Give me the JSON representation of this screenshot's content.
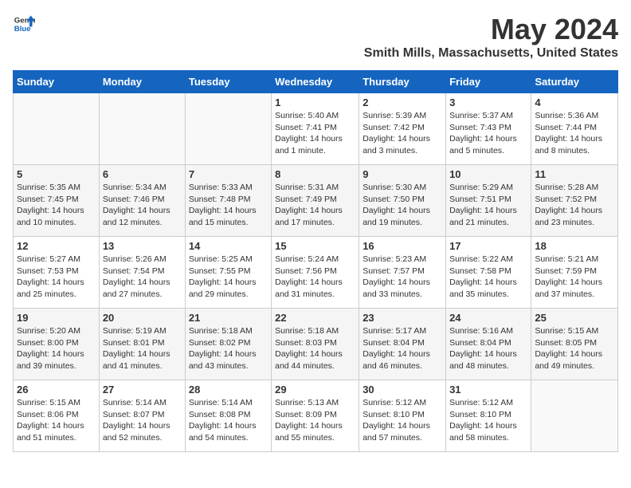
{
  "logo": {
    "text_general": "General",
    "text_blue": "Blue"
  },
  "title": "May 2024",
  "subtitle": "Smith Mills, Massachusetts, United States",
  "days_of_week": [
    "Sunday",
    "Monday",
    "Tuesday",
    "Wednesday",
    "Thursday",
    "Friday",
    "Saturday"
  ],
  "weeks": [
    [
      {
        "day": "",
        "sunrise": "",
        "sunset": "",
        "daylight": ""
      },
      {
        "day": "",
        "sunrise": "",
        "sunset": "",
        "daylight": ""
      },
      {
        "day": "",
        "sunrise": "",
        "sunset": "",
        "daylight": ""
      },
      {
        "day": "1",
        "sunrise": "Sunrise: 5:40 AM",
        "sunset": "Sunset: 7:41 PM",
        "daylight": "Daylight: 14 hours and 1 minute."
      },
      {
        "day": "2",
        "sunrise": "Sunrise: 5:39 AM",
        "sunset": "Sunset: 7:42 PM",
        "daylight": "Daylight: 14 hours and 3 minutes."
      },
      {
        "day": "3",
        "sunrise": "Sunrise: 5:37 AM",
        "sunset": "Sunset: 7:43 PM",
        "daylight": "Daylight: 14 hours and 5 minutes."
      },
      {
        "day": "4",
        "sunrise": "Sunrise: 5:36 AM",
        "sunset": "Sunset: 7:44 PM",
        "daylight": "Daylight: 14 hours and 8 minutes."
      }
    ],
    [
      {
        "day": "5",
        "sunrise": "Sunrise: 5:35 AM",
        "sunset": "Sunset: 7:45 PM",
        "daylight": "Daylight: 14 hours and 10 minutes."
      },
      {
        "day": "6",
        "sunrise": "Sunrise: 5:34 AM",
        "sunset": "Sunset: 7:46 PM",
        "daylight": "Daylight: 14 hours and 12 minutes."
      },
      {
        "day": "7",
        "sunrise": "Sunrise: 5:33 AM",
        "sunset": "Sunset: 7:48 PM",
        "daylight": "Daylight: 14 hours and 15 minutes."
      },
      {
        "day": "8",
        "sunrise": "Sunrise: 5:31 AM",
        "sunset": "Sunset: 7:49 PM",
        "daylight": "Daylight: 14 hours and 17 minutes."
      },
      {
        "day": "9",
        "sunrise": "Sunrise: 5:30 AM",
        "sunset": "Sunset: 7:50 PM",
        "daylight": "Daylight: 14 hours and 19 minutes."
      },
      {
        "day": "10",
        "sunrise": "Sunrise: 5:29 AM",
        "sunset": "Sunset: 7:51 PM",
        "daylight": "Daylight: 14 hours and 21 minutes."
      },
      {
        "day": "11",
        "sunrise": "Sunrise: 5:28 AM",
        "sunset": "Sunset: 7:52 PM",
        "daylight": "Daylight: 14 hours and 23 minutes."
      }
    ],
    [
      {
        "day": "12",
        "sunrise": "Sunrise: 5:27 AM",
        "sunset": "Sunset: 7:53 PM",
        "daylight": "Daylight: 14 hours and 25 minutes."
      },
      {
        "day": "13",
        "sunrise": "Sunrise: 5:26 AM",
        "sunset": "Sunset: 7:54 PM",
        "daylight": "Daylight: 14 hours and 27 minutes."
      },
      {
        "day": "14",
        "sunrise": "Sunrise: 5:25 AM",
        "sunset": "Sunset: 7:55 PM",
        "daylight": "Daylight: 14 hours and 29 minutes."
      },
      {
        "day": "15",
        "sunrise": "Sunrise: 5:24 AM",
        "sunset": "Sunset: 7:56 PM",
        "daylight": "Daylight: 14 hours and 31 minutes."
      },
      {
        "day": "16",
        "sunrise": "Sunrise: 5:23 AM",
        "sunset": "Sunset: 7:57 PM",
        "daylight": "Daylight: 14 hours and 33 minutes."
      },
      {
        "day": "17",
        "sunrise": "Sunrise: 5:22 AM",
        "sunset": "Sunset: 7:58 PM",
        "daylight": "Daylight: 14 hours and 35 minutes."
      },
      {
        "day": "18",
        "sunrise": "Sunrise: 5:21 AM",
        "sunset": "Sunset: 7:59 PM",
        "daylight": "Daylight: 14 hours and 37 minutes."
      }
    ],
    [
      {
        "day": "19",
        "sunrise": "Sunrise: 5:20 AM",
        "sunset": "Sunset: 8:00 PM",
        "daylight": "Daylight: 14 hours and 39 minutes."
      },
      {
        "day": "20",
        "sunrise": "Sunrise: 5:19 AM",
        "sunset": "Sunset: 8:01 PM",
        "daylight": "Daylight: 14 hours and 41 minutes."
      },
      {
        "day": "21",
        "sunrise": "Sunrise: 5:18 AM",
        "sunset": "Sunset: 8:02 PM",
        "daylight": "Daylight: 14 hours and 43 minutes."
      },
      {
        "day": "22",
        "sunrise": "Sunrise: 5:18 AM",
        "sunset": "Sunset: 8:03 PM",
        "daylight": "Daylight: 14 hours and 44 minutes."
      },
      {
        "day": "23",
        "sunrise": "Sunrise: 5:17 AM",
        "sunset": "Sunset: 8:04 PM",
        "daylight": "Daylight: 14 hours and 46 minutes."
      },
      {
        "day": "24",
        "sunrise": "Sunrise: 5:16 AM",
        "sunset": "Sunset: 8:04 PM",
        "daylight": "Daylight: 14 hours and 48 minutes."
      },
      {
        "day": "25",
        "sunrise": "Sunrise: 5:15 AM",
        "sunset": "Sunset: 8:05 PM",
        "daylight": "Daylight: 14 hours and 49 minutes."
      }
    ],
    [
      {
        "day": "26",
        "sunrise": "Sunrise: 5:15 AM",
        "sunset": "Sunset: 8:06 PM",
        "daylight": "Daylight: 14 hours and 51 minutes."
      },
      {
        "day": "27",
        "sunrise": "Sunrise: 5:14 AM",
        "sunset": "Sunset: 8:07 PM",
        "daylight": "Daylight: 14 hours and 52 minutes."
      },
      {
        "day": "28",
        "sunrise": "Sunrise: 5:14 AM",
        "sunset": "Sunset: 8:08 PM",
        "daylight": "Daylight: 14 hours and 54 minutes."
      },
      {
        "day": "29",
        "sunrise": "Sunrise: 5:13 AM",
        "sunset": "Sunset: 8:09 PM",
        "daylight": "Daylight: 14 hours and 55 minutes."
      },
      {
        "day": "30",
        "sunrise": "Sunrise: 5:12 AM",
        "sunset": "Sunset: 8:10 PM",
        "daylight": "Daylight: 14 hours and 57 minutes."
      },
      {
        "day": "31",
        "sunrise": "Sunrise: 5:12 AM",
        "sunset": "Sunset: 8:10 PM",
        "daylight": "Daylight: 14 hours and 58 minutes."
      },
      {
        "day": "",
        "sunrise": "",
        "sunset": "",
        "daylight": ""
      }
    ]
  ]
}
